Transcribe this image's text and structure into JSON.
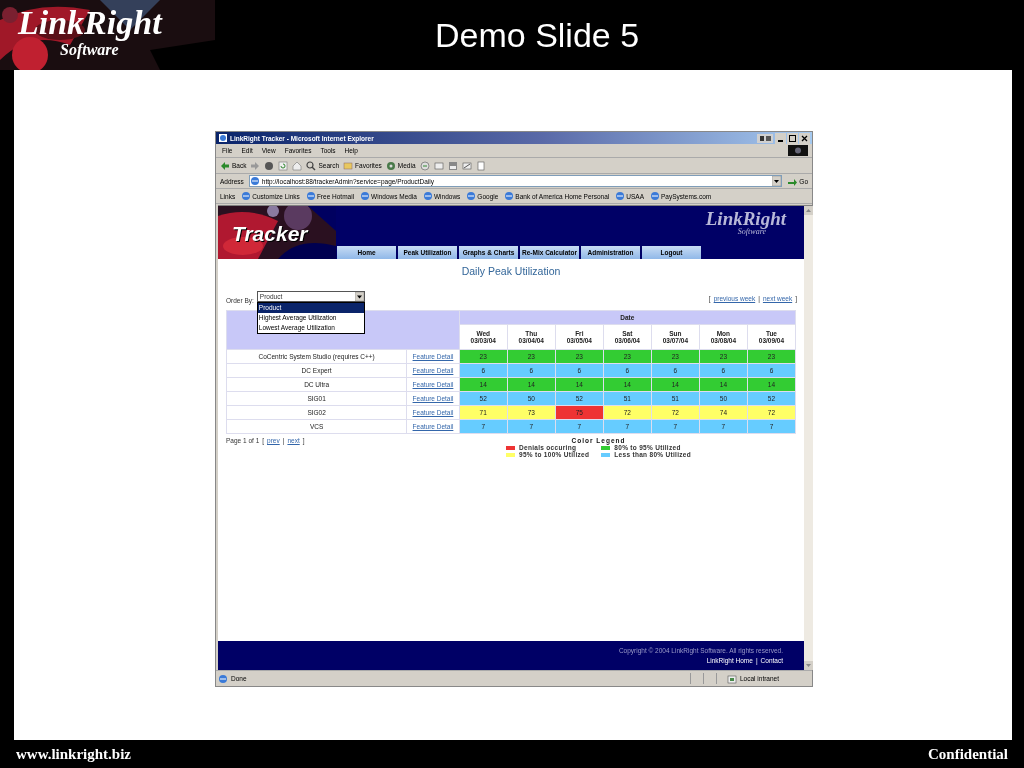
{
  "slide": {
    "logo": {
      "title": "LinkRight",
      "subtitle": "Software"
    },
    "title": "Demo Slide 5",
    "footer_left": "www.linkright.biz",
    "footer_right": "Confidential"
  },
  "browser": {
    "title": "LinkRight Tracker - Microsoft Internet Explorer",
    "menu": [
      "File",
      "Edit",
      "View",
      "Favorites",
      "Tools",
      "Help"
    ],
    "toolbar": [
      "Back",
      "Search",
      "Favorites",
      "Media"
    ],
    "address": {
      "label": "Address",
      "value": "http://localhost:88/trackerAdmin?service=page/ProductDaily",
      "go": "Go"
    },
    "links": {
      "label": "Links",
      "items": [
        "Customize Links",
        "Free Hotmail",
        "Windows Media",
        "Windows",
        "Google",
        "Bank of America  Home  Personal",
        "USAA",
        "PaySystems.com"
      ]
    },
    "status": {
      "text": "Done",
      "zone": "Local intranet"
    }
  },
  "page": {
    "brand": "Tracker",
    "logo": {
      "title": "LinkRight",
      "subtitle": "Software"
    },
    "nav": [
      "Home",
      "Peak Utilization",
      "Graphs & Charts",
      "Re-Mix Calculator",
      "Administration",
      "Logout"
    ],
    "heading": "Daily Peak Utilization",
    "order_by": {
      "label": "Order By:",
      "value": "Product",
      "options": [
        {
          "label": "Product",
          "selected": true
        },
        {
          "label": "Highest Average Utilization",
          "selected": false
        },
        {
          "label": "Lowest Average Utilization",
          "selected": false
        }
      ]
    },
    "week_nav": {
      "open": "[",
      "items": [
        "previous week",
        "next week"
      ],
      "separator": "|",
      "close": "]"
    },
    "table": {
      "group_header": "Date",
      "columns": [
        {
          "day": "Wed",
          "date": "03/03/04"
        },
        {
          "day": "Thu",
          "date": "03/04/04"
        },
        {
          "day": "Fri",
          "date": "03/05/04"
        },
        {
          "day": "Sat",
          "date": "03/06/04"
        },
        {
          "day": "Sun",
          "date": "03/07/04"
        },
        {
          "day": "Mon",
          "date": "03/08/04"
        },
        {
          "day": "Tue",
          "date": "03/09/04"
        }
      ],
      "rows": [
        {
          "product": "CoCentric System Studio (requires C++)",
          "link": "Feature Detail",
          "cells": [
            {
              "value": "23",
              "color": "#33cc33"
            },
            {
              "value": "23",
              "color": "#33cc33"
            },
            {
              "value": "23",
              "color": "#33cc33"
            },
            {
              "value": "23",
              "color": "#33cc33"
            },
            {
              "value": "23",
              "color": "#33cc33"
            },
            {
              "value": "23",
              "color": "#33cc33"
            },
            {
              "value": "23",
              "color": "#33cc33"
            }
          ]
        },
        {
          "product": "DC Expert",
          "link": "Feature Detail",
          "cells": [
            {
              "value": "6",
              "color": "#66ccff"
            },
            {
              "value": "6",
              "color": "#66ccff"
            },
            {
              "value": "6",
              "color": "#66ccff"
            },
            {
              "value": "6",
              "color": "#66ccff"
            },
            {
              "value": "6",
              "color": "#66ccff"
            },
            {
              "value": "6",
              "color": "#66ccff"
            },
            {
              "value": "6",
              "color": "#66ccff"
            }
          ]
        },
        {
          "product": "DC Ultra",
          "link": "Feature Detail",
          "cells": [
            {
              "value": "14",
              "color": "#33cc33"
            },
            {
              "value": "14",
              "color": "#33cc33"
            },
            {
              "value": "14",
              "color": "#33cc33"
            },
            {
              "value": "14",
              "color": "#33cc33"
            },
            {
              "value": "14",
              "color": "#33cc33"
            },
            {
              "value": "14",
              "color": "#33cc33"
            },
            {
              "value": "14",
              "color": "#33cc33"
            }
          ]
        },
        {
          "product": "SIG01",
          "link": "Feature Detail",
          "cells": [
            {
              "value": "52",
              "color": "#66ccff"
            },
            {
              "value": "50",
              "color": "#66ccff"
            },
            {
              "value": "52",
              "color": "#66ccff"
            },
            {
              "value": "51",
              "color": "#66ccff"
            },
            {
              "value": "51",
              "color": "#66ccff"
            },
            {
              "value": "50",
              "color": "#66ccff"
            },
            {
              "value": "52",
              "color": "#66ccff"
            }
          ]
        },
        {
          "product": "SIG02",
          "link": "Feature Detail",
          "cells": [
            {
              "value": "71",
              "color": "#ffff66"
            },
            {
              "value": "73",
              "color": "#ffff66"
            },
            {
              "value": "75",
              "color": "#ee3333"
            },
            {
              "value": "72",
              "color": "#ffff66"
            },
            {
              "value": "72",
              "color": "#ffff66"
            },
            {
              "value": "74",
              "color": "#ffff66"
            },
            {
              "value": "72",
              "color": "#ffff66"
            }
          ]
        },
        {
          "product": "VCS",
          "link": "Feature Detail",
          "cells": [
            {
              "value": "7",
              "color": "#66ccff"
            },
            {
              "value": "7",
              "color": "#66ccff"
            },
            {
              "value": "7",
              "color": "#66ccff"
            },
            {
              "value": "7",
              "color": "#66ccff"
            },
            {
              "value": "7",
              "color": "#66ccff"
            },
            {
              "value": "7",
              "color": "#66ccff"
            },
            {
              "value": "7",
              "color": "#66ccff"
            }
          ]
        }
      ]
    },
    "pagination": {
      "text": "Page 1 of 1",
      "open": "[",
      "items": [
        "prev",
        "next"
      ],
      "separator": "|",
      "close": "]"
    },
    "legend": {
      "title": "Color Legend",
      "items": [
        {
          "label": "Denials occuring",
          "color": "#ee3333"
        },
        {
          "label": "80% to 95% Utilized",
          "color": "#33cc33"
        },
        {
          "label": "95% to 100% Utilized",
          "color": "#ffff66"
        },
        {
          "label": "Less than 80% Utilized",
          "color": "#66ccff"
        }
      ]
    },
    "footer": {
      "copyright": "Copyright © 2004 LinkRight Software. All rights reserved.",
      "links": [
        "LinkRight Home",
        "Contact"
      ],
      "separator": "|"
    }
  }
}
